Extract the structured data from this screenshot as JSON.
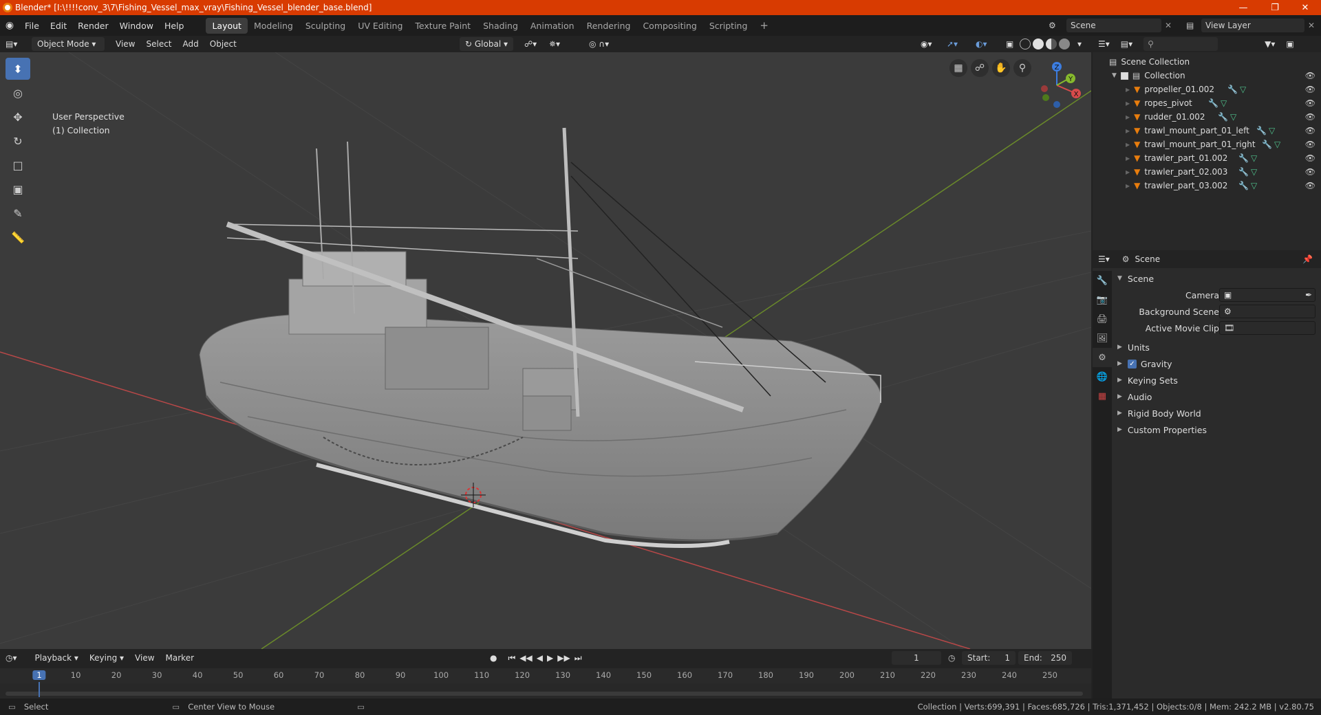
{
  "titlebar": {
    "title": "Blender* [I:\\!!!!conv_3\\7\\Fishing_Vessel_max_vray\\Fishing_Vessel_blender_base.blend]",
    "minimize": "—",
    "restore": "❐",
    "close": "✕"
  },
  "menu": {
    "items": [
      "File",
      "Edit",
      "Render",
      "Window",
      "Help"
    ]
  },
  "workspaces": {
    "tabs": [
      "Layout",
      "Modeling",
      "Sculpting",
      "UV Editing",
      "Texture Paint",
      "Shading",
      "Animation",
      "Rendering",
      "Compositing",
      "Scripting"
    ],
    "add": "+",
    "active": "Layout"
  },
  "scene_selector": {
    "value": "Scene"
  },
  "viewlayer_selector": {
    "value": "View Layer"
  },
  "viewport_header": {
    "mode": "Object Mode",
    "menus": [
      "View",
      "Select",
      "Add",
      "Object"
    ],
    "transform_orientation": "Global"
  },
  "viewport": {
    "perspective": "User Perspective",
    "collection": "(1) Collection"
  },
  "gizmo": {
    "x": "X",
    "y": "Y",
    "z": "Z"
  },
  "outliner": {
    "root": "Scene Collection",
    "collection": "Collection",
    "objects": [
      "propeller_01.002",
      "ropes_pivot",
      "rudder_01.002",
      "trawl_mount_part_01_left",
      "trawl_mount_part_01_right",
      "trawler_part_01.002",
      "trawler_part_02.003",
      "trawler_part_03.002"
    ]
  },
  "properties": {
    "header": "Scene",
    "section": "Scene",
    "fields": {
      "camera": "Camera",
      "background_scene": "Background Scene",
      "active_movie_clip": "Active Movie Clip"
    },
    "panels": {
      "units": "Units",
      "gravity": "Gravity",
      "keying_sets": "Keying Sets",
      "audio": "Audio",
      "rigid_body_world": "Rigid Body World",
      "custom_properties": "Custom Properties"
    }
  },
  "timeline": {
    "menus": [
      "Playback",
      "Keying",
      "View",
      "Marker"
    ],
    "current_frame": "1",
    "start_label": "Start:",
    "start": "1",
    "end_label": "End:",
    "end": "250",
    "ruler": [
      "1",
      "10",
      "20",
      "30",
      "40",
      "50",
      "60",
      "70",
      "80",
      "90",
      "100",
      "110",
      "120",
      "130",
      "140",
      "150",
      "160",
      "170",
      "180",
      "190",
      "200",
      "210",
      "220",
      "230",
      "240",
      "250"
    ],
    "ruler_frames": [
      1,
      10,
      20,
      30,
      40,
      50,
      60,
      70,
      80,
      90,
      100,
      110,
      120,
      130,
      140,
      150,
      160,
      170,
      180,
      190,
      200,
      210,
      220,
      230,
      240,
      250
    ]
  },
  "statusbar": {
    "left_action": "Select",
    "middle_action": "Center View to Mouse",
    "stats": "Collection | Verts:699,391 | Faces:685,726 | Tris:1,371,452 | Objects:0/8 | Mem: 242.2 MB | v2.80.75"
  },
  "colors": {
    "titlebar": "#d83b01",
    "accent": "#4772b3",
    "mesh_icon": "#e87d0d",
    "modifier_icon": "#6a9bd8",
    "data_icon": "#4fc28d"
  }
}
